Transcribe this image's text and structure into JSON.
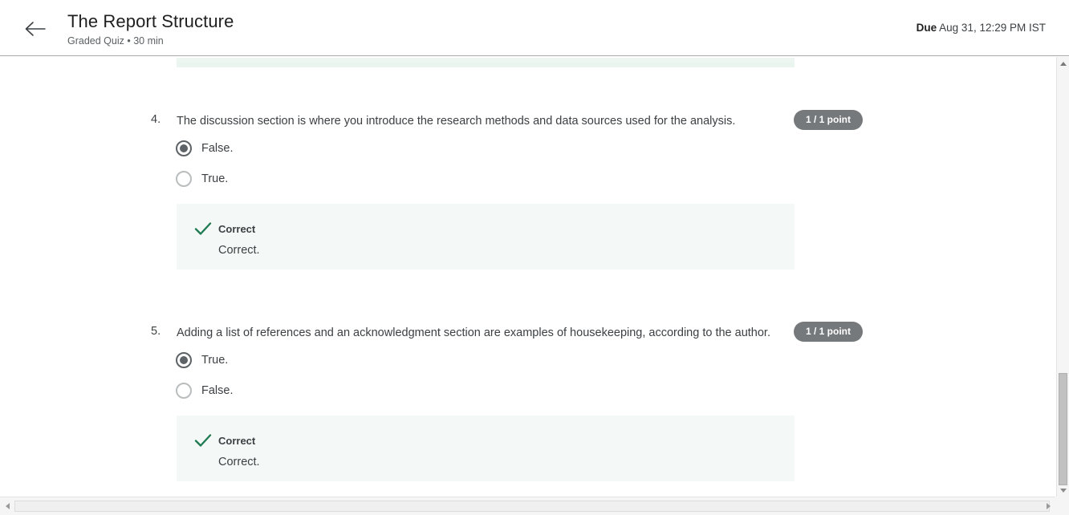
{
  "header": {
    "back_icon": "arrow-left-icon",
    "title": "The Report Structure",
    "subtitle": "Graded Quiz • 30 min",
    "due_label": "Due",
    "due_value": " Aug 31, 12:29 PM IST"
  },
  "questions": [
    {
      "number": "4.",
      "text": "The discussion section is where you introduce the research methods and data sources used for the analysis.",
      "points": "1 / 1 point",
      "options": [
        {
          "label": "False.",
          "selected": true
        },
        {
          "label": "True.",
          "selected": false
        }
      ],
      "feedback": {
        "icon": "check-icon",
        "title": "Correct",
        "body": "Correct."
      }
    },
    {
      "number": "5.",
      "text": "Adding a list of references and an acknowledgment section are examples of housekeeping, according to the author.",
      "points": "1 / 1 point",
      "options": [
        {
          "label": "True.",
          "selected": true
        },
        {
          "label": "False.",
          "selected": false
        }
      ],
      "feedback": {
        "icon": "check-icon",
        "title": "Correct",
        "body": "Correct."
      }
    }
  ],
  "colors": {
    "badge_bg": "#75797c",
    "feedback_bg": "#f4f8f6",
    "check_green": "#1f7a52",
    "partial_feedback_bg": "#eef6f2",
    "text": "#3c4043"
  },
  "scrollbars": {
    "vertical_up_icon": "triangle-up-icon",
    "vertical_down_icon": "triangle-down-icon",
    "horizontal_left_icon": "triangle-left-icon",
    "horizontal_right_icon": "triangle-right-icon"
  }
}
